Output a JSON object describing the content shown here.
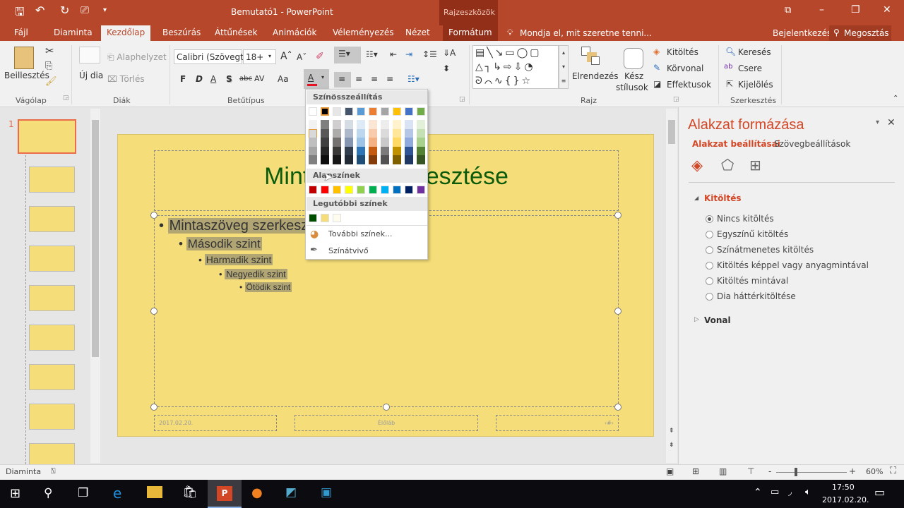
{
  "window": {
    "title": "Bemutató1 - PowerPoint",
    "context_tab_group": "Rajzeszközök"
  },
  "tabs": [
    {
      "label": "Fájl"
    },
    {
      "label": "Diaminta"
    },
    {
      "label": "Kezdőlap"
    },
    {
      "label": "Beszúrás"
    },
    {
      "label": "Áttűnések"
    },
    {
      "label": "Animációk"
    },
    {
      "label": "Véleményezés"
    },
    {
      "label": "Nézet"
    },
    {
      "label": "Formátum"
    }
  ],
  "tell_me": "Mondja el, mit szeretne tenni...",
  "signin": "Bejelentkezés",
  "share": "Megosztás",
  "ribbon": {
    "clipboard": {
      "label": "Vágólap",
      "paste": "Beillesztés"
    },
    "slides": {
      "label": "Diák",
      "new_slide": "Új dia",
      "reset": "Alaphelyzet",
      "delete": "Törlés"
    },
    "font": {
      "label": "Betűtípus",
      "font_name": "Calibri (Szövegt",
      "font_size": "18+",
      "bold": "F",
      "italic": "D",
      "underline": "A",
      "shadow": "S",
      "strike": "abc",
      "spacing": "AV",
      "case": "Aa",
      "font_color": "A",
      "font_color_bar": "#e81123"
    },
    "drawing": {
      "label": "Rajz",
      "arrange": "Elrendezés",
      "quick_styles_1": "Kész",
      "quick_styles_2": "stílusok",
      "fill": "Kitöltés",
      "outline": "Körvonal",
      "effects": "Effektusok"
    },
    "editing": {
      "label": "Szerkesztés",
      "find": "Keresés",
      "replace": "Csere",
      "select": "Kijelölés"
    }
  },
  "slide": {
    "title": "Mintacím szerkesztése",
    "levels": [
      "Mintaszöveg szerkesztése",
      "Második szint",
      "Harmadik szint",
      "Negyedik szint",
      "Ötödik szint"
    ],
    "date": "2017.02.20.",
    "footer": "Élőláb",
    "page_num": "‹#›",
    "bg": "#f5de79",
    "title_color": "#0b5b0b"
  },
  "color_menu": {
    "theme_header": "Színösszeállítás",
    "theme": [
      "#ffffff",
      "#000000",
      "#e7e6e6",
      "#44546a",
      "#5b9bd5",
      "#ed7d31",
      "#a5a5a5",
      "#ffc000",
      "#4472c4",
      "#70ad47"
    ],
    "shades": [
      [
        "#f2f2f2",
        "#d9d9d9",
        "#bfbfbf",
        "#a6a6a6",
        "#808080"
      ],
      [
        "#7f7f7f",
        "#595959",
        "#404040",
        "#262626",
        "#0d0d0d"
      ],
      [
        "#d0cece",
        "#aeabab",
        "#767171",
        "#3b3838",
        "#181717"
      ],
      [
        "#d6dce4",
        "#adb9ca",
        "#8496b0",
        "#333f4f",
        "#222a35"
      ],
      [
        "#deebf6",
        "#bdd7ee",
        "#9dc3e6",
        "#2e75b5",
        "#1f4e79"
      ],
      [
        "#fbe5d5",
        "#f7cbac",
        "#f4b183",
        "#c55a11",
        "#843c0b"
      ],
      [
        "#ededed",
        "#dbdbdb",
        "#c9c9c9",
        "#7b7b7b",
        "#525252"
      ],
      [
        "#fff2cc",
        "#ffe699",
        "#ffd966",
        "#bf9000",
        "#7f6000"
      ],
      [
        "#dae3f3",
        "#b4c7e7",
        "#8faadc",
        "#2f5597",
        "#203864"
      ],
      [
        "#e2efd9",
        "#c5e0b4",
        "#a9d18e",
        "#538135",
        "#375623"
      ]
    ],
    "standard_header": "Alapszínek",
    "standard": [
      "#c00000",
      "#ff0000",
      "#ffc000",
      "#ffff00",
      "#92d050",
      "#00b050",
      "#00b0f0",
      "#0070c0",
      "#002060",
      "#7030a0"
    ],
    "recent_header": "Legutóbbi színek",
    "recent": [
      "#004d00",
      "#f5de79",
      "#fdfcee"
    ],
    "more_colors": "További színek...",
    "eyedropper": "Színátvivő"
  },
  "pane": {
    "title": "Alakzat formázása",
    "tab_shape": "Alakzat beállításai",
    "tab_text": "Szövegbeállítások",
    "fill_section": "Kitöltés",
    "fill_options": [
      {
        "label": "Nincs kitöltés",
        "selected": true
      },
      {
        "label": "Egyszínű kitöltés",
        "selected": false
      },
      {
        "label": "Színátmenetes kitöltés",
        "selected": false
      },
      {
        "label": "Kitöltés képpel vagy anyagmintával",
        "selected": false
      },
      {
        "label": "Kitöltés mintával",
        "selected": false
      },
      {
        "label": "Dia háttérkitöltése",
        "selected": false
      }
    ],
    "line_section": "Vonal"
  },
  "thumbnails": {
    "first_number": "1"
  },
  "status": {
    "view": "Diaminta",
    "zoom": "60%",
    "zoom_min": "-",
    "zoom_max": "+"
  },
  "taskbar": {
    "time": "17:50",
    "date": "2017.02.20."
  }
}
